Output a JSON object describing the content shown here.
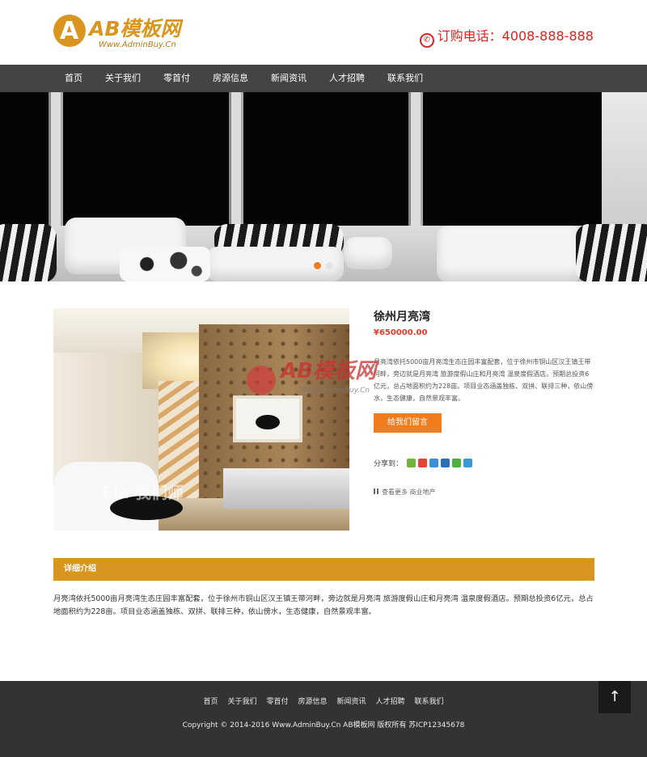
{
  "header": {
    "logo_text": "AB模板网",
    "logo_sub": "Www.AdminBuy.Cn",
    "phone_label": "订购电话：4008-888-888"
  },
  "nav": {
    "items": [
      "首页",
      "关于我们",
      "零首付",
      "房源信息",
      "新闻资讯",
      "人才招聘",
      "联系我们"
    ]
  },
  "banner": {
    "active_slide": 1,
    "slide_count": 2
  },
  "product": {
    "title": "徐州月亮湾",
    "price": "¥650000.00",
    "description": "月亮湾依托5000亩月亮湾生态庄园丰富配套，位于徐州市铜山区汉王镇王带河畔，旁边就是月亮湾 旅游度假山庄和月亮湾 温泉度假酒店。预期总投资6亿元，总占地面积约为228亩。项目业态涵盖独栋、双拼、联排三种，依山傍水，生态健康，自然景观丰富。",
    "message_button": "给我们留言",
    "share_label": "分享到：",
    "more_label": "查看更多",
    "category": "商业地产",
    "image_watermark": "Fla 我们师"
  },
  "watermark": {
    "text": "AB模板网",
    "sub": "Www.AdminBuy.Cn"
  },
  "details": {
    "heading": "详细介绍",
    "body": "月亮湾依托5000亩月亮湾生态庄园丰富配套，位于徐州市铜山区汉王镇王带河畔，旁边就是月亮湾 旅游度假山庄和月亮湾 温泉度假酒店。预期总投资6亿元，总占地面积约为228亩。项目业态涵盖独栋、双拼、联排三种，依山傍水，生态健康，自然景观丰富。"
  },
  "footer": {
    "nav_items": [
      "首页",
      "关于我们",
      "零首付",
      "房源信息",
      "新闻资讯",
      "人才招聘",
      "联系我们"
    ],
    "copyright": "Copyright © 2014-2016 Www.AdminBuy.Cn AB模板网 版权所有  苏ICP12345678"
  },
  "back_to_top": "↑",
  "colors": {
    "accent": "#d8961f",
    "button": "#f07c1d",
    "price": "#e53b2c",
    "phone": "#dd2222",
    "nav_bg": "#444444",
    "footer_bg": "#333333"
  },
  "share_icons": [
    "qzone-icon",
    "weibo-icon",
    "tencent-weibo-icon",
    "renren-icon",
    "wechat-icon",
    "more-share-icon"
  ]
}
